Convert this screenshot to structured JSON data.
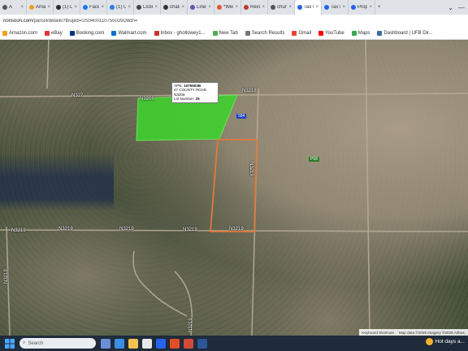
{
  "browser": {
    "tabs": [
      {
        "label": "A",
        "color": "#555555"
      },
      {
        "label": "Amazon",
        "color": "#f0a020"
      },
      {
        "label": "(1) Linkedin",
        "color": "#2b2b2b"
      },
      {
        "label": "Facebook",
        "color": "#1877f2"
      },
      {
        "label": "(1) Unre",
        "color": "#2f7de1"
      },
      {
        "label": "Listing",
        "color": "#444444"
      },
      {
        "label": "chatgpt",
        "color": "#333333"
      },
      {
        "label": "Linemen",
        "color": "#6a4fb5"
      },
      {
        "label": "*Wei",
        "color": "#e05a2a"
      },
      {
        "label": "Rexmls",
        "color": "#c0392b"
      },
      {
        "label": "chuny",
        "color": "#555555"
      },
      {
        "label": "Tax Info",
        "color": "#2563eb",
        "active": true
      },
      {
        "label": "Tax Info",
        "color": "#2563eb"
      },
      {
        "label": "Propert",
        "color": "#2563eb"
      }
    ],
    "new_tab_symbol": "+",
    "controls": [
      "⌄",
      "—"
    ],
    "address": {
      "host": "nonsoon.com",
      "path": "/parcel/details?tbupid=US0400110755029D8dn="
    },
    "bookmarks": [
      {
        "label": "Amazon.com",
        "color": "#f0a020"
      },
      {
        "label": "eBay",
        "color": "#e53238"
      },
      {
        "label": "Booking.com",
        "color": "#003580"
      },
      {
        "label": "Walmart.com",
        "color": "#0071ce"
      },
      {
        "label": "Inbox - ghollowey1...",
        "color": "#c0392b"
      },
      {
        "label": "New Tab",
        "color": "#4caf50"
      },
      {
        "label": "Search Results",
        "color": "#777777"
      },
      {
        "label": "Gmail",
        "color": "#ea4335"
      },
      {
        "label": "YouTube",
        "color": "#ff0000"
      },
      {
        "label": "Maps",
        "color": "#34a853"
      },
      {
        "label": "Dashboard | UFB Dir...",
        "color": "#3a6ea5"
      }
    ]
  },
  "map": {
    "road_labels": {
      "n3219_left_a": "N3219",
      "n3219_left_b": "N3219",
      "n3219_mid": "N3219",
      "n3219_right": "N3219",
      "n3218": "N3218",
      "n327_top": "N327",
      "n3208": "N3208",
      "vertical_left": "N3219",
      "vertical_center": "N3219",
      "vertical_bottom": "N3219",
      "vertical_right": "N3218"
    },
    "badge_blue": "584",
    "badge_green": "P58",
    "popup": {
      "apn_label": "APN:",
      "apn_value": "1075502B",
      "address": "47 COUNTY ROAD N3208",
      "lot_label": "Lot Number:",
      "lot_value": "25"
    },
    "highlight_color": "#3fcf2f",
    "parcel_outline_color": "#e07a3a",
    "footer": {
      "shortcuts": "Keyboard shortcuts",
      "attribution": "Map data ©2025 Imagery ©2025 Airbus,"
    }
  },
  "taskbar": {
    "search_placeholder": "Search",
    "weather": "Hot days a..."
  }
}
